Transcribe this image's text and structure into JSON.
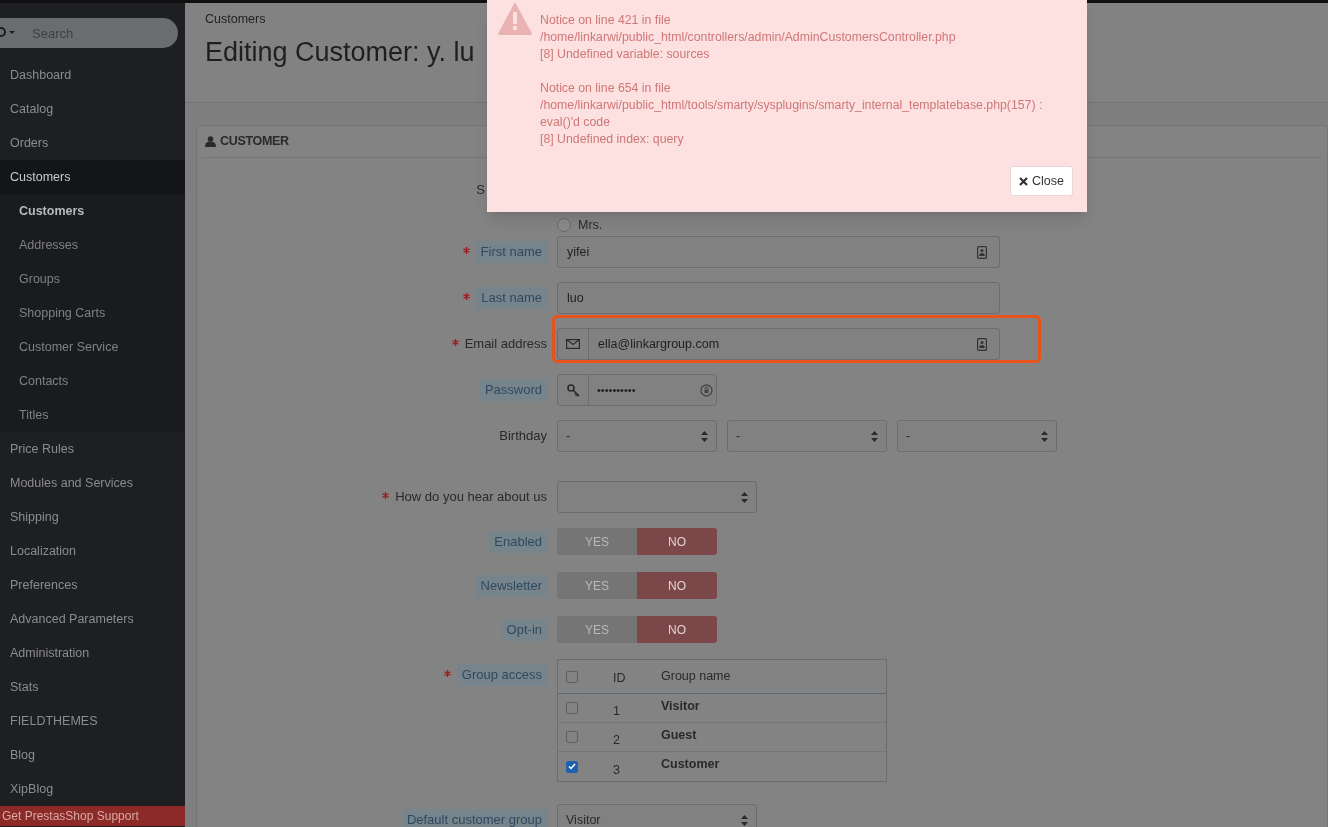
{
  "sidebar": {
    "search": {
      "placeholder": "Search"
    },
    "items": [
      {
        "label": "Dashboard",
        "selected": false
      },
      {
        "label": "Catalog",
        "selected": false
      },
      {
        "label": "Orders",
        "selected": false
      },
      {
        "label": "Customers",
        "selected": true,
        "children": [
          {
            "label": "Customers",
            "selected": true
          },
          {
            "label": "Addresses",
            "selected": false
          },
          {
            "label": "Groups",
            "selected": false
          },
          {
            "label": "Shopping Carts",
            "selected": false
          },
          {
            "label": "Customer Service",
            "selected": false
          },
          {
            "label": "Contacts",
            "selected": false
          },
          {
            "label": "Titles",
            "selected": false
          }
        ]
      },
      {
        "label": "Price Rules",
        "selected": false
      },
      {
        "label": "Modules and Services",
        "selected": false
      },
      {
        "label": "Shipping",
        "selected": false
      },
      {
        "label": "Localization",
        "selected": false
      },
      {
        "label": "Preferences",
        "selected": false
      },
      {
        "label": "Advanced Parameters",
        "selected": false
      },
      {
        "label": "Administration",
        "selected": false
      },
      {
        "label": "Stats",
        "selected": false
      },
      {
        "label": "FIELDTHEMES",
        "selected": false
      },
      {
        "label": "Blog",
        "selected": false
      },
      {
        "label": "XipBlog",
        "selected": false
      }
    ],
    "support_link": "Get PrestasShop Support"
  },
  "breadcrumb": "Customers",
  "page_title": "Editing Customer: y. lu",
  "panel": {
    "title": "CUSTOMER",
    "social_title": {
      "label": "S",
      "options": [
        {
          "label": "Mrs.",
          "selected": false
        }
      ]
    },
    "fields": [
      {
        "kind": "text",
        "label": "First name",
        "required": true,
        "hint": true,
        "value": "yifei",
        "autofill_icon": true,
        "highlighted": false
      },
      {
        "kind": "text",
        "label": "Last name",
        "required": true,
        "hint": true,
        "value": "luo",
        "autofill_icon": false,
        "highlighted": false
      },
      {
        "kind": "email",
        "label": "Email address",
        "required": true,
        "hint": false,
        "value": "ella@linkargroup.com",
        "autofill_icon": true,
        "highlighted": true
      },
      {
        "kind": "password",
        "label": "Password",
        "required": false,
        "hint": true,
        "value": "••••••••••"
      },
      {
        "kind": "date",
        "label": "Birthday",
        "required": false,
        "hint": false,
        "selects": [
          "-",
          "-",
          "-"
        ]
      },
      {
        "kind": "select",
        "label": "How do you hear about us",
        "required": true,
        "hint": false
      },
      {
        "kind": "toggle",
        "label": "Enabled",
        "required": false,
        "hint": true,
        "options": [
          "YES",
          "NO"
        ],
        "on": false
      },
      {
        "kind": "toggle",
        "label": "Newsletter",
        "required": false,
        "hint": true,
        "options": [
          "YES",
          "NO"
        ],
        "on": false
      },
      {
        "kind": "toggle",
        "label": "Opt-in",
        "required": false,
        "hint": true,
        "options": [
          "YES",
          "NO"
        ],
        "on": false
      },
      {
        "kind": "groups",
        "label": "Group access",
        "required": true,
        "hint": true,
        "all_checked": false,
        "columns": [
          "ID",
          "Group name"
        ],
        "rows": [
          {
            "id": "1",
            "name": "Visitor",
            "checked": false
          },
          {
            "id": "2",
            "name": "Guest",
            "checked": false
          },
          {
            "id": "3",
            "name": "Customer",
            "checked": true
          }
        ]
      },
      {
        "kind": "select",
        "label": "Default customer group",
        "required": false,
        "hint": true,
        "value": "Visitor"
      }
    ]
  },
  "alert": {
    "messages": [
      {
        "lines": [
          "Notice on line 421 in file",
          "/home/linkarwi/public_html/controllers/admin/AdminCustomersController.php",
          "[8] Undefined variable: sources"
        ]
      },
      {
        "lines": [
          "Notice on line 654 in file",
          "/home/linkarwi/public_html/tools/smarty/sysplugins/smarty_internal_templatebase.php(157) :",
          "eval()'d code",
          "[8] Undefined index: query"
        ]
      }
    ],
    "close_button": "Close"
  }
}
